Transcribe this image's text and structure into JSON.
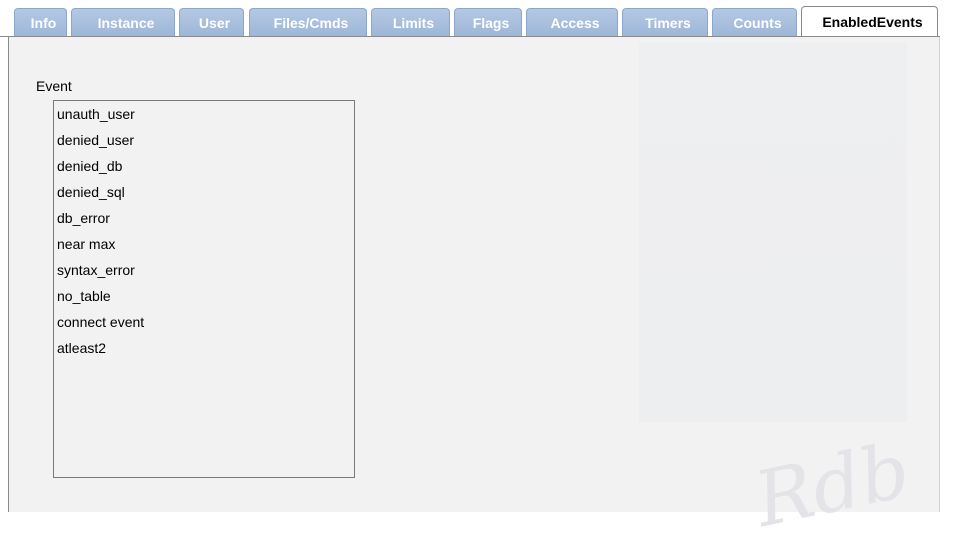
{
  "tabs": [
    {
      "label": "Info",
      "active": false
    },
    {
      "label": "Instance",
      "active": false
    },
    {
      "label": "User",
      "active": false
    },
    {
      "label": "Files/Cmds",
      "active": false
    },
    {
      "label": "Limits",
      "active": false
    },
    {
      "label": "Flags",
      "active": false
    },
    {
      "label": "Access",
      "active": false
    },
    {
      "label": "Timers",
      "active": false
    },
    {
      "label": "Counts",
      "active": false
    },
    {
      "label": "EnabledEvents",
      "active": true
    }
  ],
  "event_section": {
    "label": "Event",
    "items": [
      "unauth_user",
      "denied_user",
      "denied_db",
      "denied_sql",
      "db_error",
      "near max",
      "syntax_error",
      "no_table",
      "connect event",
      "atleast2"
    ]
  },
  "colors": {
    "tab_inactive": "#a9bfdf",
    "tab_active": "#ffffff",
    "panel_background": "#f2f2f2",
    "border": "#8a8a8a"
  }
}
